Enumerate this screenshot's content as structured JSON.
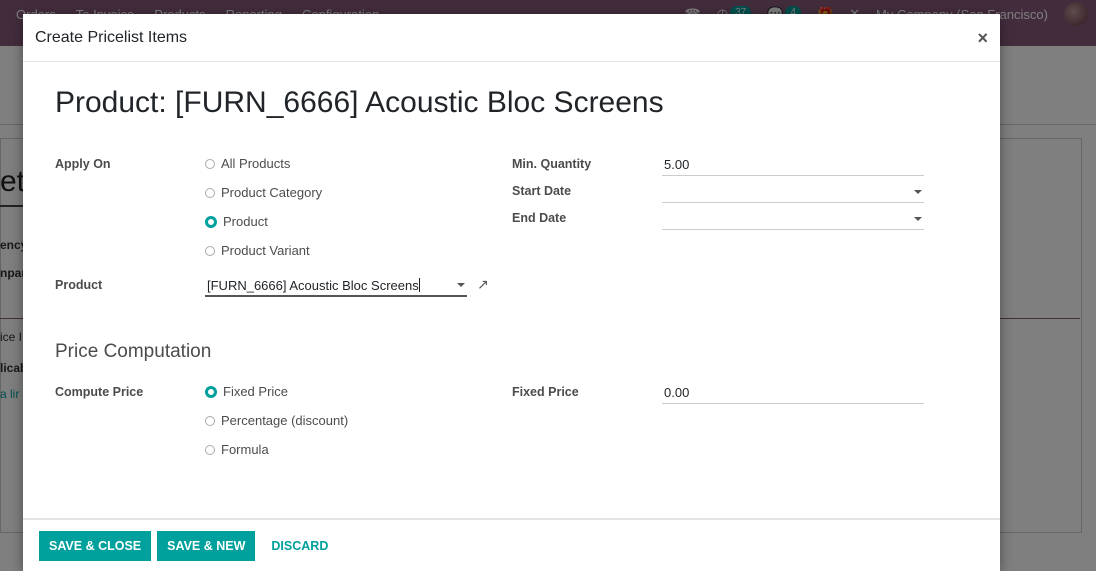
{
  "navbar": {
    "menu": [
      "Orders",
      "To Invoice",
      "Products",
      "Reporting",
      "Configuration"
    ],
    "activity_count": "37",
    "messages_count": "4",
    "company": "My Company (San Francisco)"
  },
  "background": {
    "title_fragment": "et",
    "labels": [
      "ency",
      "npan"
    ],
    "texts": [
      "ice I",
      "licab"
    ],
    "link": "a lir"
  },
  "modal": {
    "title": "Create Pricelist Items",
    "record_title": "Product: [FURN_6666] Acoustic Bloc Screens",
    "apply_on": {
      "label": "Apply On",
      "options": [
        {
          "label": "All Products",
          "checked": false
        },
        {
          "label": "Product Category",
          "checked": false
        },
        {
          "label": "Product",
          "checked": true
        },
        {
          "label": "Product Variant",
          "checked": false
        }
      ]
    },
    "product": {
      "label": "Product",
      "value": "[FURN_6666] Acoustic Bloc Screens"
    },
    "min_quantity": {
      "label": "Min. Quantity",
      "value": "5.00"
    },
    "start_date": {
      "label": "Start Date",
      "value": ""
    },
    "end_date": {
      "label": "End Date",
      "value": ""
    },
    "price_section": "Price Computation",
    "compute_price": {
      "label": "Compute Price",
      "options": [
        {
          "label": "Fixed Price",
          "checked": true
        },
        {
          "label": "Percentage (discount)",
          "checked": false
        },
        {
          "label": "Formula",
          "checked": false
        }
      ]
    },
    "fixed_price": {
      "label": "Fixed Price",
      "value": "0.00"
    },
    "footer": {
      "save_close": "SAVE & CLOSE",
      "save_new": "SAVE & NEW",
      "discard": "DISCARD"
    }
  },
  "colors": {
    "brand": "#875a7b",
    "accent": "#00a09d"
  }
}
